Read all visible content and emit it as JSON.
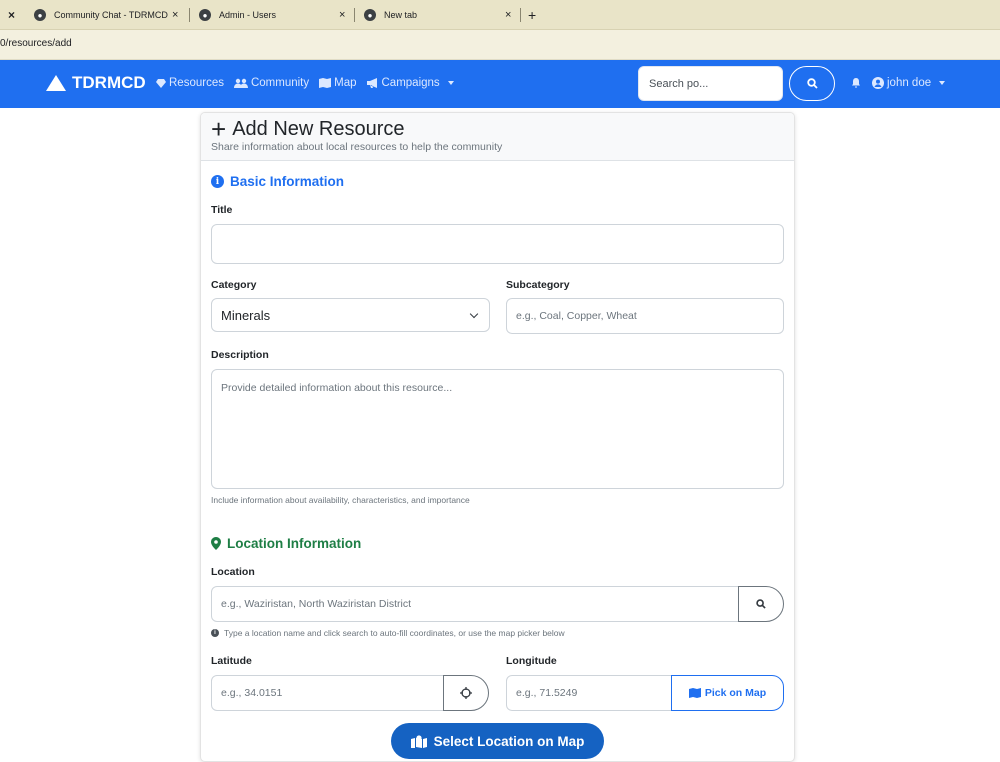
{
  "browser": {
    "tabs": [
      {
        "close": "×",
        "title": ""
      },
      {
        "title": "Community Chat - TDRMCD",
        "close": "×"
      },
      {
        "title": "Admin - Users",
        "close": "×"
      },
      {
        "title": "New tab",
        "close": "×"
      }
    ],
    "new_tab": "+",
    "url": "0/resources/add"
  },
  "navbar": {
    "brand": "TDRMCD",
    "links": [
      {
        "label": "Resources",
        "icon": "gem-icon"
      },
      {
        "label": "Community",
        "icon": "users-icon"
      },
      {
        "label": "Map",
        "icon": "map-icon"
      },
      {
        "label": "Campaigns",
        "icon": "bullhorn-icon"
      }
    ],
    "search_placeholder": "Search po...",
    "user": "john doe"
  },
  "form": {
    "title": "Add New Resource",
    "subtitle": "Share information about local resources to help the community",
    "basic_section": "Basic Information",
    "title_label": "Title",
    "title_value": "",
    "category_label": "Category",
    "category_value": "Minerals",
    "subcategory_label": "Subcategory",
    "subcategory_placeholder": "e.g., Coal, Copper, Wheat",
    "description_label": "Description",
    "description_placeholder": "Provide detailed information about this resource...",
    "description_help": "Include information about availability, characteristics, and importance",
    "location_section": "Location Information",
    "location_label": "Location",
    "location_placeholder": "e.g., Waziristan, North Waziristan District",
    "location_help": "Type a location name and click search to auto-fill coordinates, or use the map picker below",
    "latitude_label": "Latitude",
    "latitude_placeholder": "e.g., 34.0151",
    "longitude_label": "Longitude",
    "longitude_placeholder": "e.g., 71.5249",
    "pick_on_map": "Pick on Map",
    "select_location_button": "Select Location on Map"
  },
  "colors": {
    "primary": "#1f6ff0",
    "success": "#1e7e45"
  }
}
